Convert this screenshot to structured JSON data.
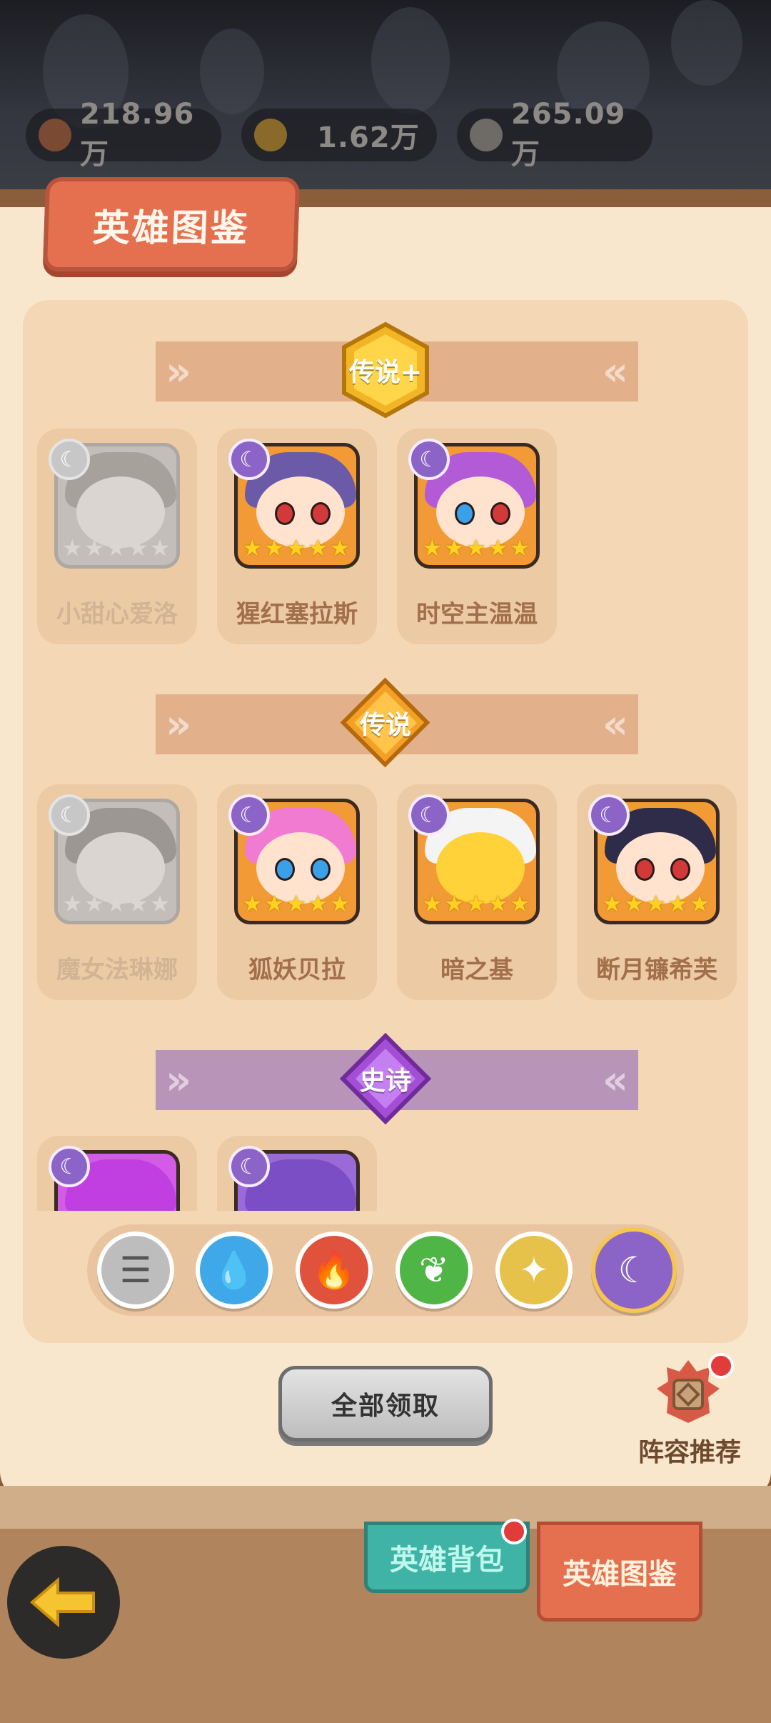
{
  "resources": [
    {
      "icon": "meat-icon",
      "value": "218.96万"
    },
    {
      "icon": "gold-pile-icon",
      "value": "1.62万"
    },
    {
      "icon": "coin-icon",
      "value": "265.09万"
    }
  ],
  "title": "英雄图鉴",
  "sections": [
    {
      "tier": "传说+",
      "heroes": [
        {
          "name": "小甜心爱洛",
          "owned": false,
          "stars": 5
        },
        {
          "name": "猩红塞拉斯",
          "owned": true,
          "stars": 5
        },
        {
          "name": "时空主温温",
          "owned": true,
          "stars": 5
        }
      ]
    },
    {
      "tier": "传说",
      "heroes": [
        {
          "name": "魔女法琳娜",
          "owned": false,
          "stars": 5
        },
        {
          "name": "狐妖贝拉",
          "owned": true,
          "stars": 5
        },
        {
          "name": "暗之基",
          "owned": true,
          "stars": 5
        },
        {
          "name": "断月镰希芙",
          "owned": true,
          "stars": 5
        }
      ]
    },
    {
      "tier": "史诗",
      "heroes": [
        {
          "name": "",
          "owned": true
        },
        {
          "name": "",
          "owned": true
        }
      ]
    }
  ],
  "filters": [
    {
      "icon": "list-icon",
      "color": "#bdbdbd"
    },
    {
      "icon": "water-icon",
      "color": "#3fa8e8"
    },
    {
      "icon": "fire-icon",
      "color": "#e0523b"
    },
    {
      "icon": "leaf-icon",
      "color": "#4fb545"
    },
    {
      "icon": "light-icon",
      "color": "#e6c24b"
    },
    {
      "icon": "moon-icon",
      "color": "#8c64c8",
      "active": true
    }
  ],
  "claim_all": "全部领取",
  "lineup_recommend": "阵容推荐",
  "tabs": {
    "bag": "英雄背包",
    "atlas": "英雄图鉴"
  },
  "colors": {
    "accent": "#e5704f",
    "legend_ribbon": "#e2b08a",
    "epic_ribbon": "#b894b9"
  }
}
